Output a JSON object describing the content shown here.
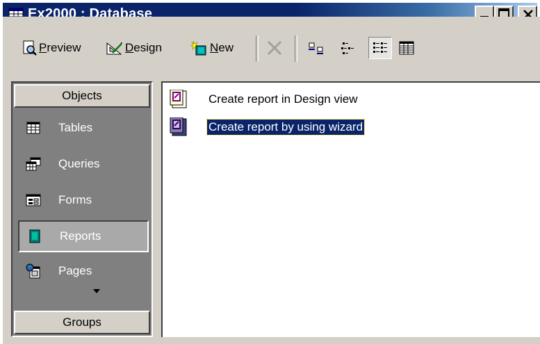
{
  "window": {
    "title": "Ex2000 : Database"
  },
  "toolbar": {
    "preview": {
      "prefix": "",
      "accel": "P",
      "rest": "review"
    },
    "design": {
      "prefix": "",
      "accel": "D",
      "rest": "esign"
    },
    "new": {
      "prefix": "",
      "accel": "N",
      "rest": "ew"
    }
  },
  "objects_bar": {
    "header": "Objects",
    "items": [
      {
        "label": "Tables",
        "icon": "table-icon"
      },
      {
        "label": "Queries",
        "icon": "query-icon"
      },
      {
        "label": "Forms",
        "icon": "form-icon"
      },
      {
        "label": "Reports",
        "icon": "report-icon",
        "selected": true
      },
      {
        "label": "Pages",
        "icon": "page-icon"
      }
    ],
    "groups_header": "Groups"
  },
  "list": {
    "items": [
      {
        "label": "Create report in Design view",
        "icon": "report-design-icon"
      },
      {
        "label": "Create report by using wizard",
        "icon": "report-wizard-icon",
        "selected": true
      }
    ]
  },
  "colors": {
    "title_bar": "#0a246a",
    "face": "#d4d0c8",
    "panel": "#808080",
    "selection": "#0a246a"
  }
}
